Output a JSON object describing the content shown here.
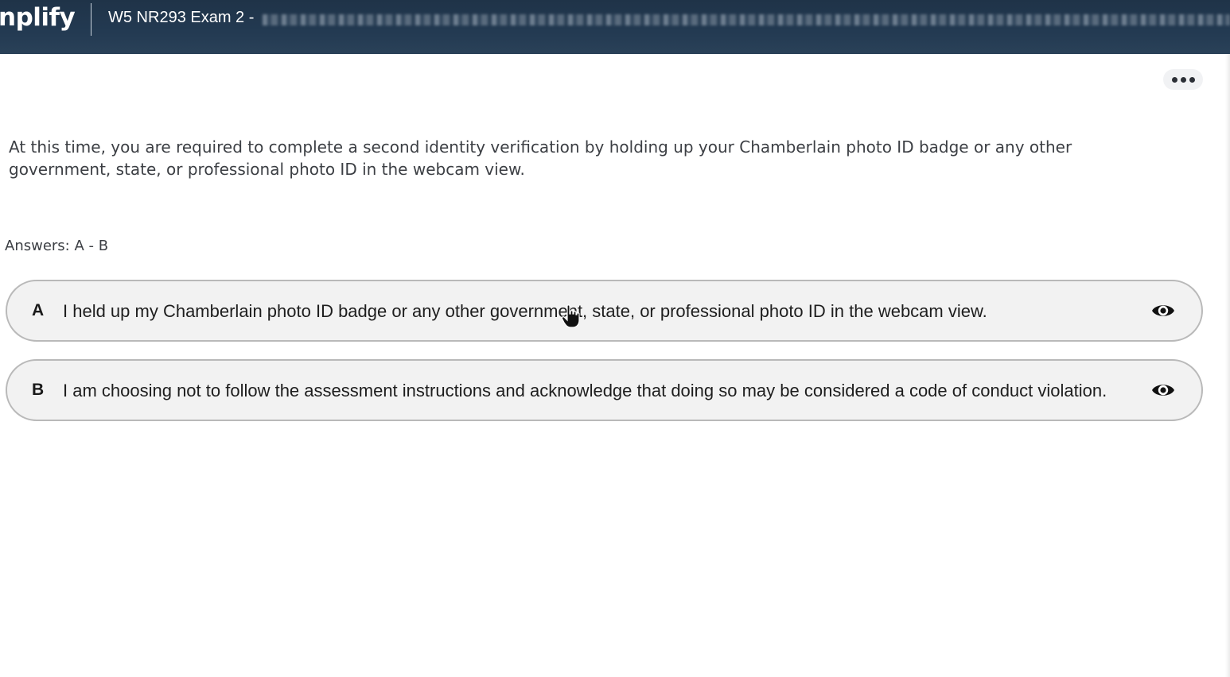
{
  "header": {
    "brand": "nplify",
    "exam_title": "W5 NR293 Exam 2 -"
  },
  "menu": {
    "more_icon": "more-horizontal-icon"
  },
  "question": {
    "instructions": "At this time, you are required to complete a second identity verification by holding up your Chamberlain photo ID badge or any other government, state, or professional photo ID in the webcam view."
  },
  "answers": {
    "label": "Answers: A - B",
    "options": [
      {
        "letter": "A",
        "text": "I held up my Chamberlain photo ID badge or any other government, state, or professional photo ID in the webcam view.",
        "icon": "eye-icon"
      },
      {
        "letter": "B",
        "text": "I am choosing not to follow the assessment instructions and acknowledge that doing so may be considered a code of conduct violation.",
        "icon": "eye-icon"
      }
    ]
  },
  "colors": {
    "header_bg": "#233a52",
    "option_bg": "#f2f2f2",
    "option_border": "#b9b9b9"
  }
}
